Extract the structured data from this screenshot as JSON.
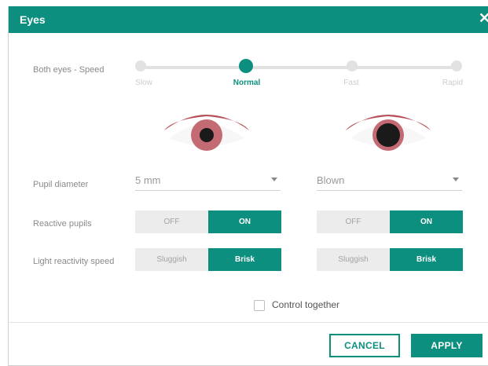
{
  "dialog": {
    "title": "Eyes",
    "close_icon": "close-icon"
  },
  "speed": {
    "label": "Both eyes - Speed",
    "options": [
      "Slow",
      "Normal",
      "Fast",
      "Rapid"
    ],
    "selected": "Normal"
  },
  "pupil": {
    "label": "Pupil diameter",
    "left_value": "5 mm",
    "right_value": "Blown"
  },
  "reactive": {
    "label": "Reactive pupils",
    "off_label": "OFF",
    "on_label": "ON",
    "left_selected": "ON",
    "right_selected": "ON"
  },
  "light": {
    "label": "Light reactivity speed",
    "option_a": "Sluggish",
    "option_b": "Brisk",
    "left_selected": "Brisk",
    "right_selected": "Brisk"
  },
  "control_together": {
    "label": "Control together",
    "checked": false
  },
  "footer": {
    "cancel_label": "CANCEL",
    "apply_label": "APPLY"
  },
  "colors": {
    "accent": "#0d8f7f",
    "eyelid": "#b8505a",
    "iris": "#c46a73"
  }
}
